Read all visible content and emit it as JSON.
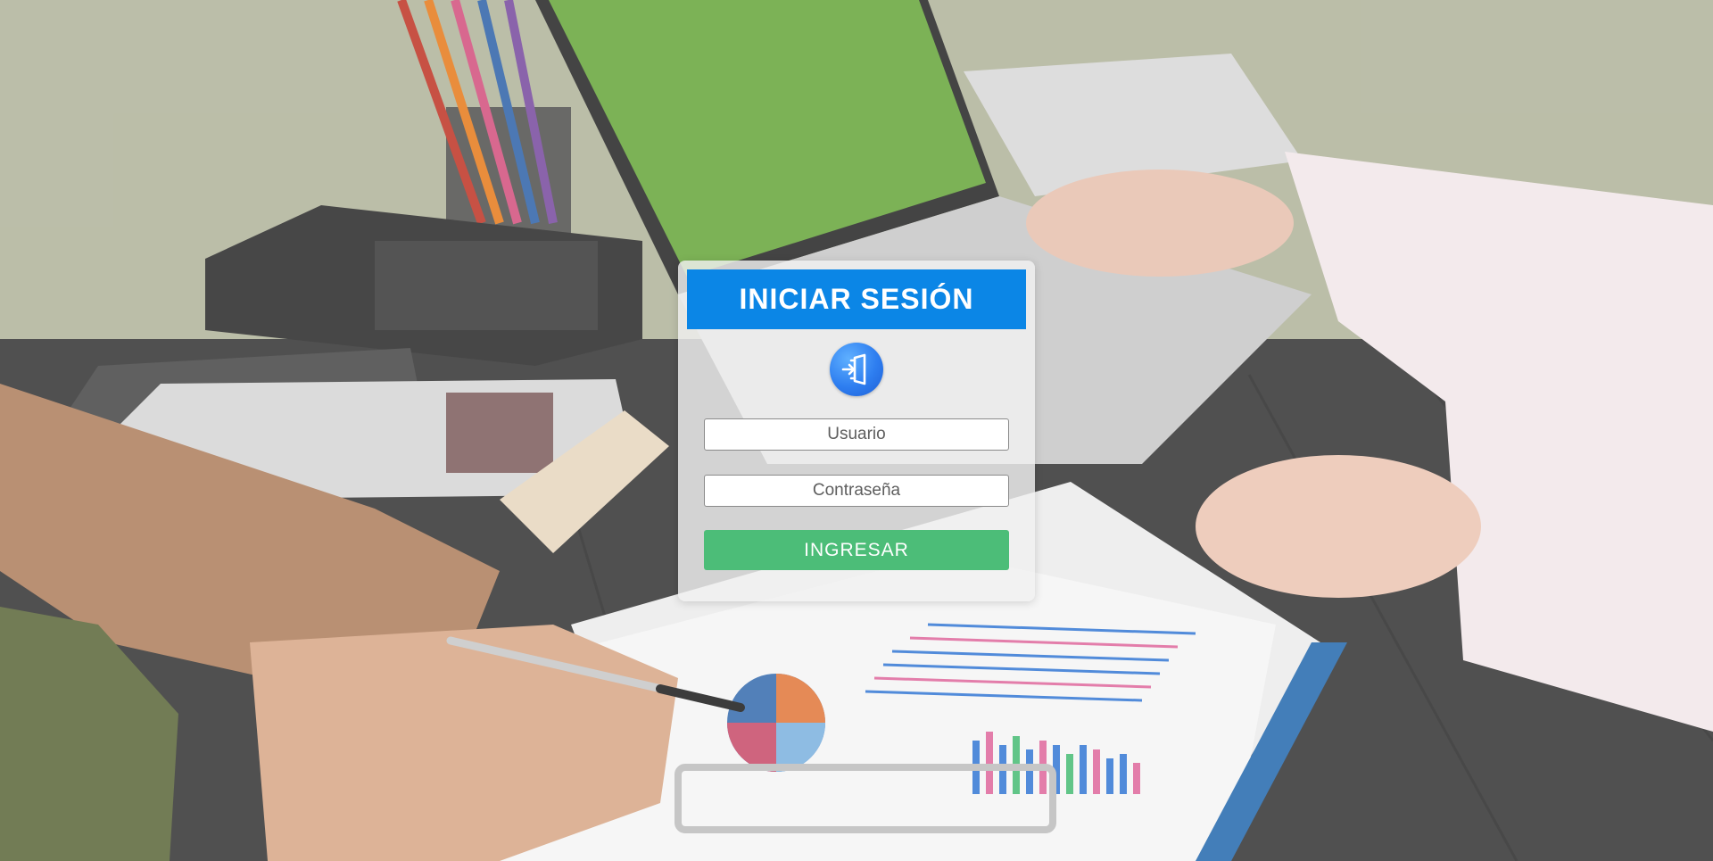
{
  "login": {
    "title": "INICIAR SESIÓN",
    "icon": "login-door-icon",
    "username_placeholder": "Usuario",
    "password_placeholder": "Contraseña",
    "submit_label": "INGRESAR"
  },
  "colors": {
    "header": "#0b86e6",
    "submit": "#4cbd78",
    "icon": "#2e7ef0"
  }
}
